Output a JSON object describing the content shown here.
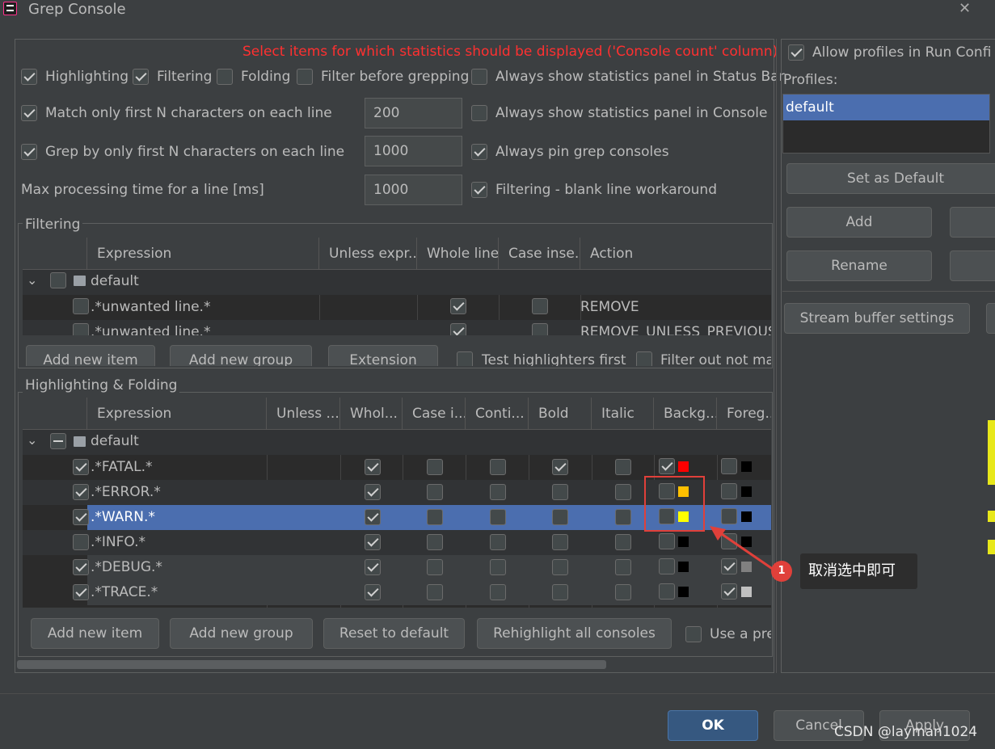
{
  "window": {
    "title": "Grep Console",
    "close_glyph": "✕"
  },
  "general": {
    "notice": "Select items for which statistics should be displayed ('Console count' column)",
    "highlighting": "Highlighting",
    "filtering": "Filtering",
    "folding": "Folding",
    "filter_before": "Filter before grepping",
    "always_status_bar": "Always show statistics panel in Status Bar",
    "match_first_n": "Match only first N characters on each line",
    "match_first_n_value": "200",
    "always_console": "Always show statistics panel in Console",
    "grep_first_n": "Grep by only first N characters on each line",
    "grep_first_n_value": "1000",
    "always_pin": "Always pin grep consoles",
    "max_processing": "Max processing time for a line [ms]",
    "max_processing_value": "1000",
    "blank_line": "Filtering - blank line workaround"
  },
  "filtering": {
    "title": "Filtering",
    "columns": [
      "Expression",
      "Unless expr...",
      "Whole line",
      "Case inse...",
      "Action"
    ],
    "group": "default",
    "rows": [
      {
        "expr": ".*unwanted line.*",
        "action": "REMOVE"
      },
      {
        "expr": ".*unwanted line.*",
        "action": "REMOVE_UNLESS_PREVIOUS"
      }
    ],
    "buttons": [
      "Add new item",
      "Add new group",
      "Extension"
    ],
    "test_first": "Test highlighters first",
    "filter_out": "Filter out not ma"
  },
  "highlighting": {
    "title": "Highlighting & Folding",
    "columns": [
      "Expression",
      "Unless ...",
      "Whol...",
      "Case i...",
      "Conti...",
      "Bold",
      "Italic",
      "Backg...",
      "Foreg..."
    ],
    "group": "default",
    "rows": [
      {
        "expr": ".*FATAL.*",
        "bg": "#ff0000",
        "fg": "#000000"
      },
      {
        "expr": ".*ERROR.*",
        "bg": "#ffc000",
        "fg": "#000000"
      },
      {
        "expr": ".*WARN.*",
        "bg": "#ffff00",
        "fg": "#000000"
      },
      {
        "expr": ".*INFO.*",
        "bg": "#000000",
        "fg": "#000000"
      },
      {
        "expr": ".*DEBUG.*",
        "bg": "#000000",
        "fg": "#808080"
      },
      {
        "expr": ".*TRACE.*",
        "bg": "#000000",
        "fg": "#c0c0c0"
      }
    ],
    "buttons": [
      "Add new item",
      "Add new group",
      "Reset to default",
      "Rehighlight all consoles"
    ],
    "use_pre": "Use a pre"
  },
  "profiles": {
    "allow": "Allow profiles in Run Confi",
    "label": "Profiles:",
    "items": [
      "default"
    ],
    "set_default": "Set as Default",
    "add": "Add",
    "rename": "Rename",
    "stream": "Stream buffer settings"
  },
  "annotation": {
    "badge": "1",
    "text": "取消选中即可"
  },
  "footer": {
    "ok": "OK",
    "cancel": "Cancel",
    "apply": "Apply",
    "watermark": "CSDN @layman1024"
  },
  "colors": {
    "accent_selection": "#4b6eaf",
    "notice_red": "#ff3030",
    "annotation_red": "#e0403a",
    "ok_button": "#365880"
  }
}
